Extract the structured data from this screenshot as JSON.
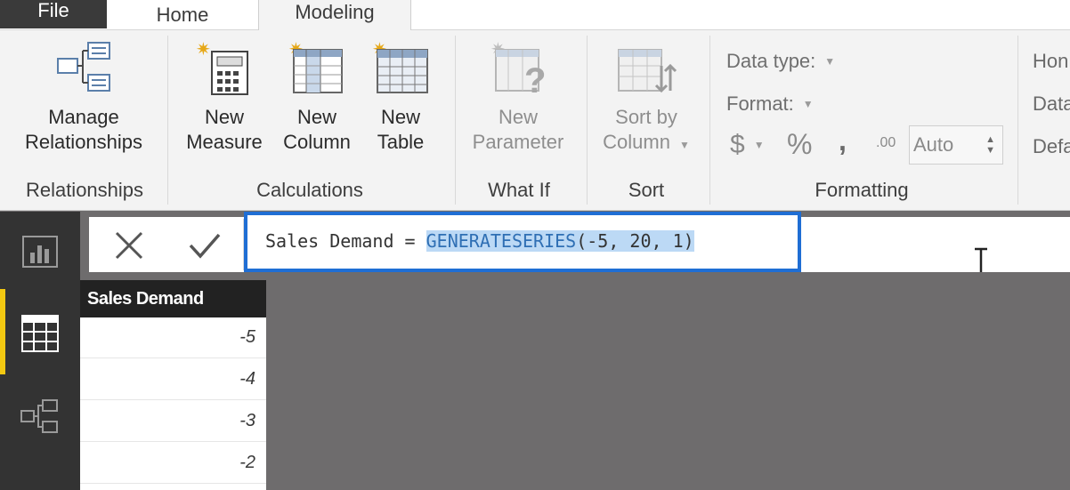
{
  "tabs": {
    "file": "File",
    "home": "Home",
    "modeling": "Modeling"
  },
  "ribbon": {
    "relationships": {
      "manage_line1": "Manage",
      "manage_line2": "Relationships",
      "group": "Relationships"
    },
    "calculations": {
      "new_measure_1": "New",
      "new_measure_2": "Measure",
      "new_column_1": "New",
      "new_column_2": "Column",
      "new_table_1": "New",
      "new_table_2": "Table",
      "group": "Calculations"
    },
    "whatif": {
      "new_param_1": "New",
      "new_param_2": "Parameter",
      "group": "What If"
    },
    "sort": {
      "sort_by_1": "Sort by",
      "sort_by_2": "Column",
      "group": "Sort"
    },
    "formatting": {
      "data_type": "Data type:",
      "format": "Format:",
      "currency": "$",
      "percent": "%",
      "comma": ",",
      "decimals": ".00",
      "auto": "Auto",
      "group": "Formatting"
    },
    "properties_cut": {
      "line1": "Hon",
      "line2": "Data",
      "line3": "Defa"
    }
  },
  "formula": {
    "prefix": "Sales Demand = ",
    "highlight_fn": "GENERATESERIES",
    "highlight_args": "(-5, 20, 1)"
  },
  "grid": {
    "header": "Sales Demand",
    "rows": [
      "-5",
      "-4",
      "-3",
      "-2"
    ]
  },
  "colors": {
    "accent_blue": "#1f6ed4",
    "rail": "#333333",
    "active_marker": "#f2c811",
    "canvas": "#6e6c6d"
  }
}
